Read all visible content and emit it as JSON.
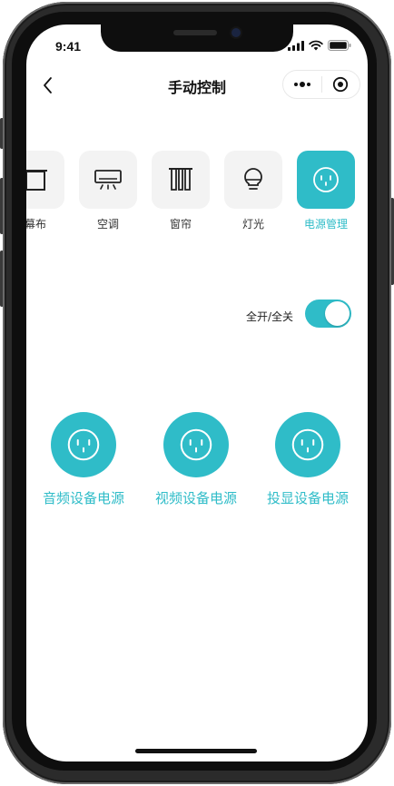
{
  "status_bar": {
    "time": "9:41"
  },
  "nav": {
    "title": "手动控制",
    "back_icon": "chevron-left-icon",
    "more_icon": "more-dots-icon",
    "close_icon": "target-icon"
  },
  "tabs": [
    {
      "label": "幕布",
      "icon": "screen-icon",
      "active": false
    },
    {
      "label": "空调",
      "icon": "air-conditioner-icon",
      "active": false
    },
    {
      "label": "窗帘",
      "icon": "curtain-icon",
      "active": false
    },
    {
      "label": "灯光",
      "icon": "bulb-icon",
      "active": false
    },
    {
      "label": "电源管理",
      "icon": "power-outlet-icon",
      "active": true
    }
  ],
  "all_toggle": {
    "label": "全开/全关",
    "on": true
  },
  "devices": [
    {
      "label": "音频设备电源",
      "icon": "power-outlet-icon"
    },
    {
      "label": "视频设备电源",
      "icon": "power-outlet-icon"
    },
    {
      "label": "投显设备电源",
      "icon": "power-outlet-icon"
    }
  ],
  "colors": {
    "accent": "#2fbcc8",
    "tab_bg": "#f3f3f3",
    "frame": "#2b2b2b"
  }
}
